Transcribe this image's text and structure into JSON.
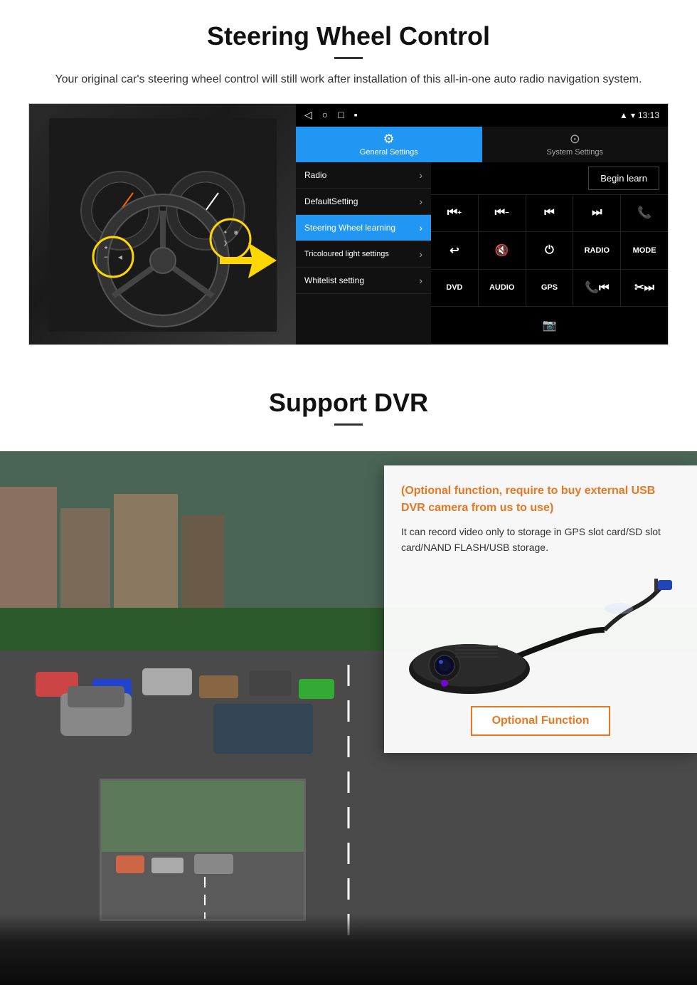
{
  "steering": {
    "title": "Steering Wheel Control",
    "subtitle": "Your original car's steering wheel control will still work after installation of this all-in-one auto radio navigation system.",
    "android": {
      "time": "13:13",
      "tab_general": "General Settings",
      "tab_system": "System Settings",
      "menu": [
        {
          "label": "Radio",
          "active": false
        },
        {
          "label": "DefaultSetting",
          "active": false
        },
        {
          "label": "Steering Wheel learning",
          "active": true
        },
        {
          "label": "Tricoloured light settings",
          "active": false
        },
        {
          "label": "Whitelist setting",
          "active": false
        }
      ],
      "begin_learn": "Begin learn",
      "controls_row1": [
        "⏮+",
        "⏮−",
        "⏮⏮",
        "⏭⏭",
        "📞"
      ],
      "controls_row2": [
        "↩",
        "🔇",
        "⏻",
        "RADIO",
        "MODE"
      ],
      "controls_row3": [
        "DVD",
        "AUDIO",
        "GPS",
        "📞⏮",
        "✂⏭"
      ],
      "controls_row4": [
        "📷"
      ]
    }
  },
  "dvr": {
    "title": "Support DVR",
    "optional_text": "(Optional function, require to buy external USB DVR camera from us to use)",
    "description": "It can record video only to storage in GPS slot card/SD slot card/NAND FLASH/USB storage.",
    "optional_function_btn": "Optional Function"
  }
}
